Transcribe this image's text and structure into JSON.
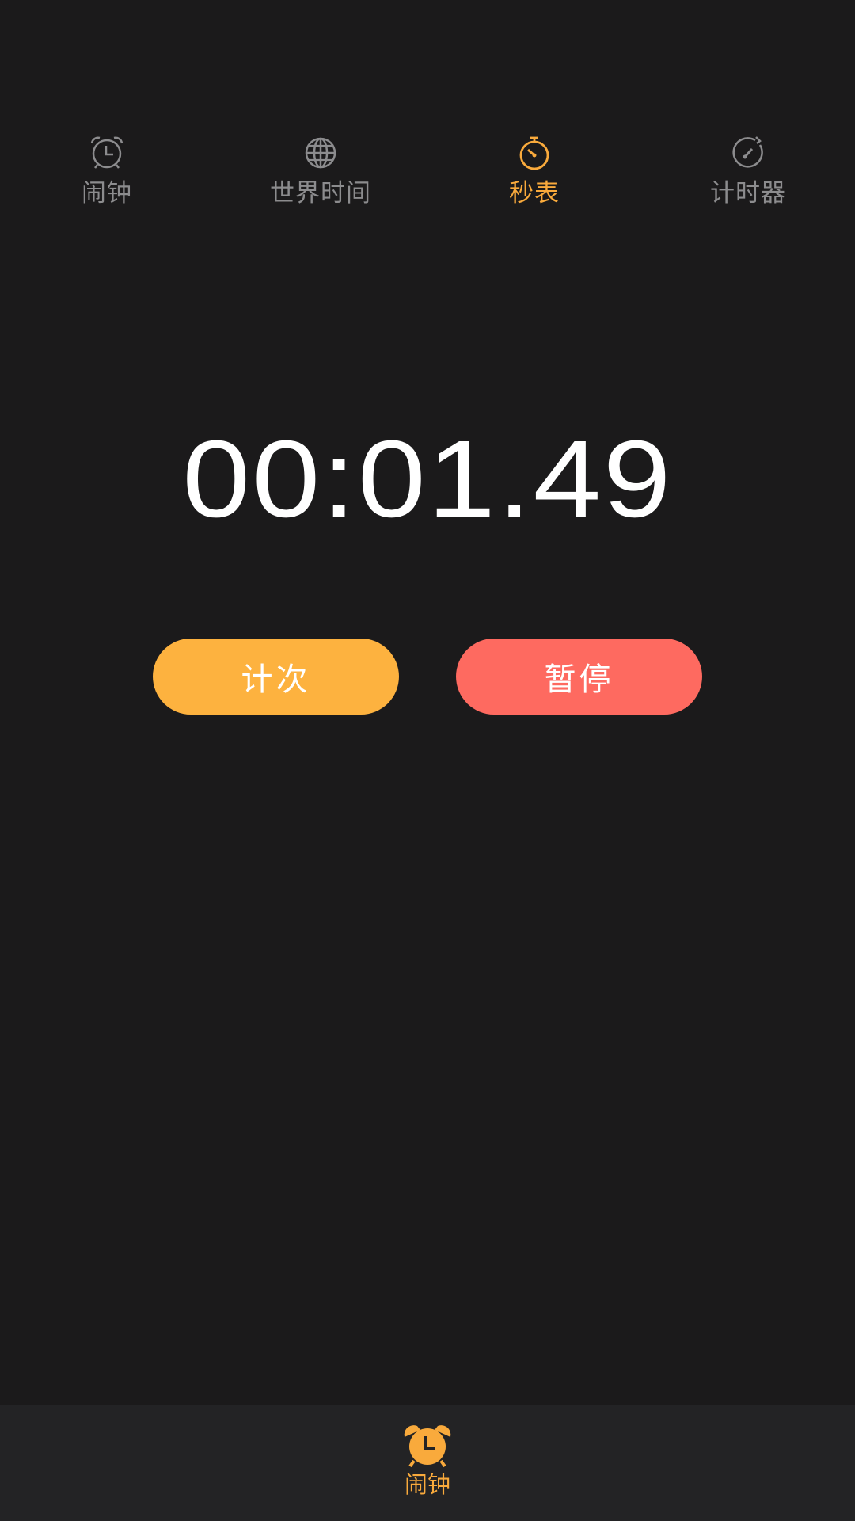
{
  "tabs": [
    {
      "label": "闹钟",
      "icon": "alarm-clock-icon",
      "active": false
    },
    {
      "label": "世界时间",
      "icon": "globe-icon",
      "active": false
    },
    {
      "label": "秒表",
      "icon": "stopwatch-icon",
      "active": true
    },
    {
      "label": "计时器",
      "icon": "timer-icon",
      "active": false
    }
  ],
  "stopwatch": {
    "time": "00:01.49"
  },
  "buttons": {
    "lap_label": "计次",
    "pause_label": "暂停"
  },
  "bottom_nav": {
    "label": "闹钟",
    "icon": "alarm-clock-icon"
  },
  "colors": {
    "background": "#1b1a1b",
    "accent": "#f9aa3c",
    "inactive": "#8c8c8e",
    "lap_button": "#fdb23f",
    "pause_button": "#fe6a60",
    "bottom_bar": "#232325"
  }
}
